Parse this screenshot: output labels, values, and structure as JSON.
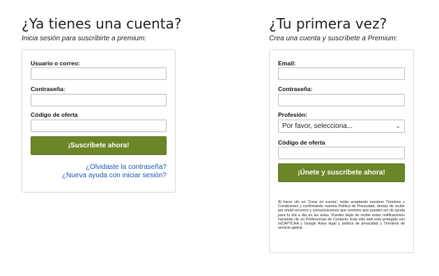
{
  "login": {
    "title": "¿Ya tienes una cuenta?",
    "subtitle": "Inicia sesión para suscribirte a premium:",
    "user_label": "Usuario o correo:",
    "password_label": "Contraseña:",
    "offer_label": "Código de oferta",
    "user_value": "",
    "password_value": "",
    "offer_value": "",
    "submit_label": "¡Suscríbete ahora!",
    "forgot_link": "¿Olvidaste la contraseña?",
    "help_link": "¿Nueva ayuda con iniciar sesión?"
  },
  "signup": {
    "title": "¿Tu primera vez?",
    "subtitle": "Crea una cuenta y suscríbete a Premium:",
    "email_label": "Email:",
    "password_label": "Contraseña:",
    "profession_label": "Profesión:",
    "profession_selected": "Por favor, selecciona...",
    "offer_label": "Código de oferta",
    "email_value": "",
    "password_value": "",
    "offer_value": "",
    "submit_label": "¡Únete y suscríbete ahora!",
    "legal_text": "Al hacer clic en 'Crear mi cuenta', estás aceptando nuestros Términos y Condiciones y confirmando nuestra Política de Privacidad, demás de recibir por email recursos y comunicaciones que creemos que pueden ser de ayuda para tu día a día en las aulas. Puedes dejar de recibir estas notificaciones haciendo clic en Preferencias de Contacto- Este sitio web está protegido con reCAPTCHA y Google Aviso legal y política de privacidad y Términos de servicio aplicar."
  },
  "icons": {
    "select_chevron": "chevron-down-icon"
  },
  "colors": {
    "button_green": "#6b8626",
    "link_blue": "#1a56b3"
  }
}
